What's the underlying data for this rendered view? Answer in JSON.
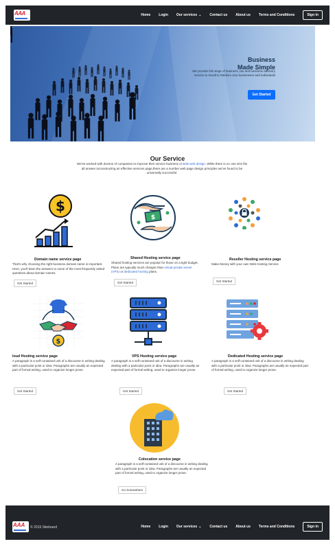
{
  "nav": {
    "links": [
      "Home",
      "Login",
      "Our services",
      "Contact us",
      "About us",
      "Terms and Conditions"
    ],
    "signin": "Sign In",
    "logo_text": "AAA"
  },
  "hero": {
    "title_line1": "Business",
    "title_line2": "Made Simple",
    "text": "We provide full range of business ,tax and business advisory service to Small to Medium size businesses and individuals",
    "button": "Get Started"
  },
  "services": {
    "title": "Our Service",
    "sub_a": "We've worked with dozens of companies to improve their service business or ",
    "sub_link": "B2B web design",
    "sub_b": ". While there is no one size fits all answer toconstructing an effective services page,there are a number web page design principles we've found to be universally successful.",
    "items": [
      {
        "title": "Domain name service page",
        "text": "That's why choosing the right business domain name is important. Here, you'll learn the answers to some of the most frequently asked questions about domain names.",
        "button": "Get Started",
        "icon": "growth-chart-dollar-icon"
      },
      {
        "title": "Shared Hosting service page",
        "text_a": "Shared hosting services are popular for those on a tight budget. Plans are typically much cheaper than ",
        "link1": "virtual private server (VPS)",
        "text_b": " or ",
        "link2": "dedicated hosting",
        "text_c": " plans.",
        "button": "Get Started",
        "icon": "hands-money-icon"
      },
      {
        "title": "Reseller Hosting service page",
        "text": "Make Money with your own Web Hosting Service",
        "button": "Get Started",
        "icon": "network-lock-icon"
      },
      {
        "title": "loud Hosting service page",
        "text": "A paragraph is a self-contained unit of a discourse in writing dealing with a particular point or idea. Paragraphs are usually an expected part of formal writing, used to organize longer prose.",
        "button": "Get Started",
        "icon": "handshake-exchange-icon"
      },
      {
        "title": "VPS Hosting service page",
        "text": "A paragraph is a self-contained unit of a discourse in writing dealing with a particular point or idea. Paragraphs are usually an expected part of formal writing, used to organize longer prose.",
        "button": "Get Started",
        "icon": "server-rack-icon"
      },
      {
        "title": "Dedicated Hosting service page",
        "text": "A paragraph is a self-contained unit of a discourse in writing dealing with a particular point or idea. Paragraphs are usually an expected part of formal writing, used to organize longer prose.",
        "button": "Get Started",
        "icon": "server-gear-icon"
      },
      {
        "title": "Colocation service page",
        "text": "A paragraph is a self-contained unit of a discourse in writing dealing with a particular point or idea. Paragraphs are usually an expected part of formal writing, used to organize longer prose.",
        "button": "Go Somewhere",
        "icon": "building-cloud-icon"
      }
    ]
  },
  "footer": {
    "copyright": "© 2019 Sitebrand",
    "links": [
      "Home",
      "Login",
      "Our services",
      "Contact us",
      "About us",
      "Terms and Conditions"
    ],
    "signin": "Sign In",
    "logo_text": "AAA"
  },
  "colors": {
    "nav_bg": "#212529",
    "primary": "#0d6efd",
    "link": "#2d6ad6"
  }
}
